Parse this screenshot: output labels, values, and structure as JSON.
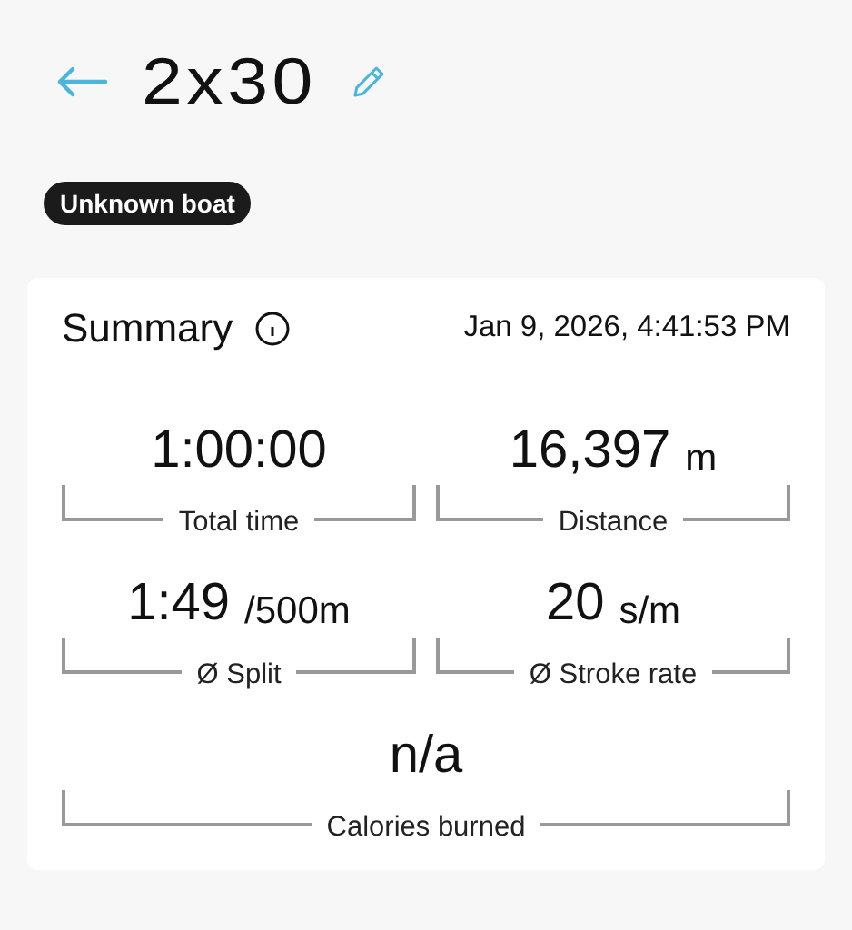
{
  "header": {
    "title": "2x30"
  },
  "badge": "Unknown boat",
  "summary": {
    "title": "Summary",
    "date": "Jan 9, 2026, 4:41:53 PM",
    "metrics": [
      {
        "kind": "half",
        "value": "1:00:00",
        "label": "Total time"
      },
      {
        "kind": "half",
        "value": "16,397",
        "unit": "m",
        "label": "Distance"
      },
      {
        "kind": "half",
        "value": "1:49",
        "unit": "/500m",
        "label": "Ø Split"
      },
      {
        "kind": "half",
        "value": "20",
        "unit": "s/m",
        "label": "Ø Stroke rate"
      },
      {
        "kind": "full",
        "value": "n/a",
        "label": "Calories burned"
      }
    ]
  }
}
